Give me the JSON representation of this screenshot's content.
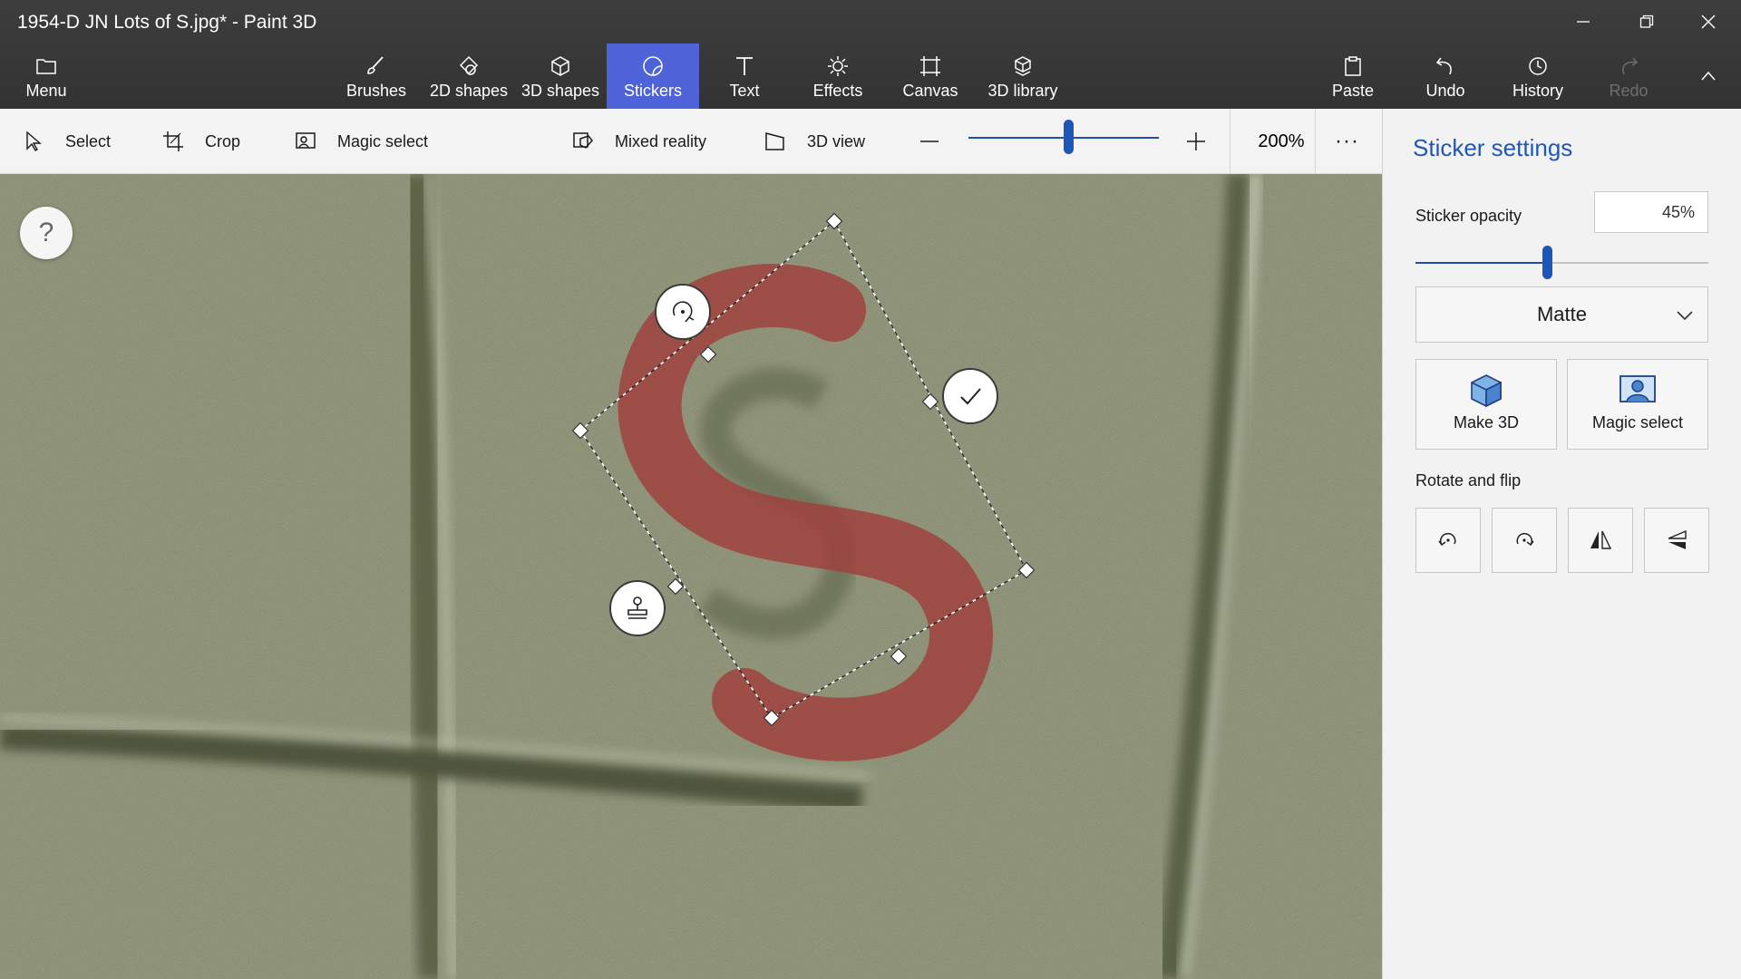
{
  "window": {
    "title": "1954-D JN Lots of S.jpg* - Paint 3D",
    "controls": [
      "minimize-icon",
      "restore-icon",
      "close-icon"
    ]
  },
  "ribbon": {
    "menu_label": "Menu",
    "tabs": [
      {
        "label": "Brushes",
        "icon": "brush-icon"
      },
      {
        "label": "2D shapes",
        "icon": "2d-shapes-icon"
      },
      {
        "label": "3D shapes",
        "icon": "cube-icon"
      },
      {
        "label": "Stickers",
        "icon": "stickers-icon",
        "active": true
      },
      {
        "label": "Text",
        "icon": "text-icon"
      },
      {
        "label": "Effects",
        "icon": "sun-icon"
      },
      {
        "label": "Canvas",
        "icon": "canvas-icon"
      },
      {
        "label": "3D library",
        "icon": "3d-library-icon"
      }
    ],
    "actions": [
      {
        "label": "Paste",
        "icon": "clipboard-icon"
      },
      {
        "label": "Undo",
        "icon": "undo-icon"
      },
      {
        "label": "History",
        "icon": "history-icon"
      },
      {
        "label": "Redo",
        "icon": "redo-icon",
        "disabled": true
      }
    ]
  },
  "toolbar": {
    "select_label": "Select",
    "crop_label": "Crop",
    "magic_select_label": "Magic select",
    "mixed_reality_label": "Mixed reality",
    "view3d_label": "3D view",
    "zoom_value": "200%",
    "zoom_slider_level": 0.5,
    "more_label": "···"
  },
  "canvas": {
    "help_label": "?",
    "sticker_color": "#a0403c"
  },
  "panel": {
    "title": "Sticker settings",
    "opacity_label": "Sticker opacity",
    "opacity_value": "45%",
    "opacity_level": 0.45,
    "finish_value": "Matte",
    "make3d_label": "Make 3D",
    "magic_select_label": "Magic select",
    "rotate_flip_label": "Rotate and flip"
  },
  "colors": {
    "accent": "#4e63d8",
    "accent_text": "#1f57b8",
    "chrome_bg": "#3a3a3a"
  }
}
